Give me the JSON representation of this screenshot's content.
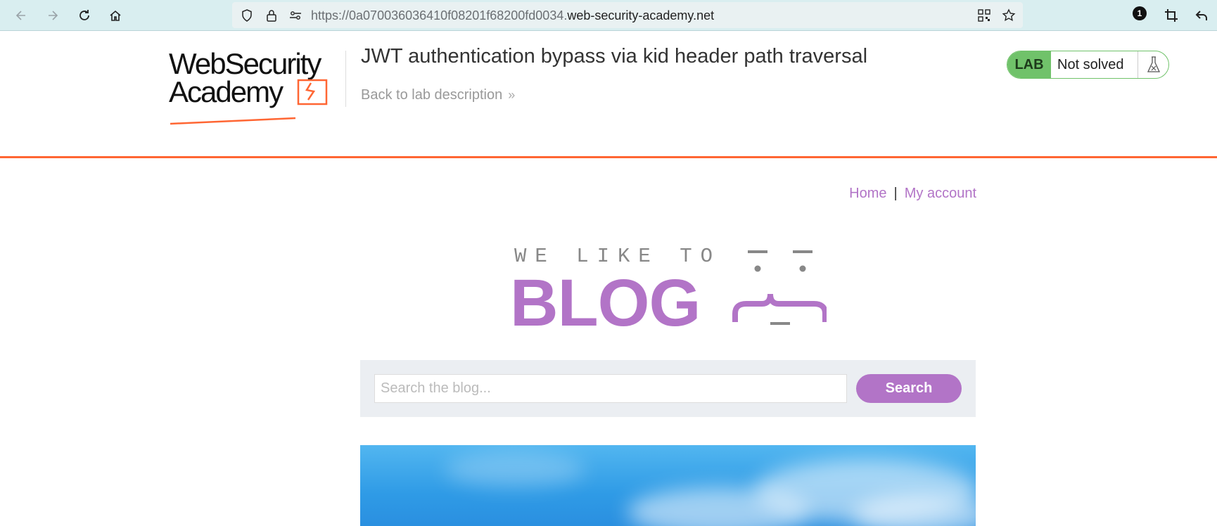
{
  "browser": {
    "url_prefix": "https://0a070036036410f08201f68200fd0034.",
    "url_domain": "web-security-academy.net",
    "extension_badge": "1"
  },
  "header": {
    "logo_line1": "WebSecurity",
    "logo_line2": "Academy",
    "lab_title": "JWT authentication bypass via kid header path traversal",
    "back_link": "Back to lab description",
    "lab_tag": "LAB",
    "lab_status": "Not solved"
  },
  "nav": {
    "home": "Home",
    "separator": "|",
    "account": "My account"
  },
  "blog": {
    "tagline": "WE LIKE TO",
    "word": "BLOG"
  },
  "search": {
    "placeholder": "Search the blog...",
    "button": "Search"
  },
  "colors": {
    "accent": "#b274c7",
    "brand_orange": "#ff6633",
    "lab_green": "#70c26a"
  }
}
